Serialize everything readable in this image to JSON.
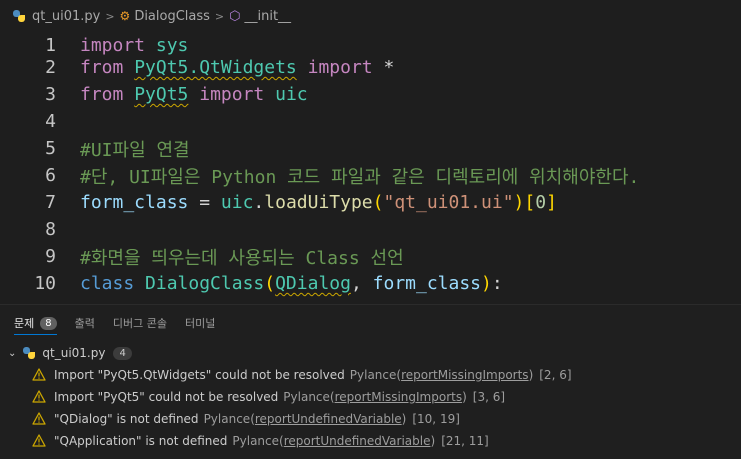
{
  "breadcrumb": {
    "file": "qt_ui01.py",
    "class": "DialogClass",
    "method": "__init__"
  },
  "editor": {
    "line_numbers": [
      "1",
      "2",
      "3",
      "4",
      "5",
      "6",
      "7",
      "8",
      "9",
      "10"
    ],
    "lines": {
      "l1": {
        "kw": "import",
        "mod": "sys"
      },
      "l2": {
        "kw": "from",
        "mod": "PyQt5.QtWidgets",
        "kw2": "import",
        "op": "*"
      },
      "l3": {
        "kw": "from",
        "mod": "PyQt5",
        "kw2": "import",
        "id": "uic"
      },
      "l5": {
        "comment": "#UI파일 연결"
      },
      "l6": {
        "comment": "#단, UI파일은 Python 코드 파일과 같은 디렉토리에 위치해야한다."
      },
      "l7": {
        "var": "form_class",
        "eq": "=",
        "mod": "uic",
        "dot": ".",
        "fn": "loadUiType",
        "open": "(",
        "str": "\"qt_ui01.ui\"",
        "close": ")",
        "idx_open": "[",
        "num": "0",
        "idx_close": "]"
      },
      "l9": {
        "comment": "#화면을 띄우는데 사용되는 Class 선언"
      },
      "l10": {
        "kw": "class",
        "name": "DialogClass",
        "open": "(",
        "base1": "QDialog",
        "comma": ",",
        "base2": "form_class",
        "close": ")",
        "colon": ":"
      }
    }
  },
  "panel": {
    "tabs": [
      {
        "label": "문제",
        "badge": "8"
      },
      {
        "label": "출력"
      },
      {
        "label": "디버그 콘솔"
      },
      {
        "label": "터미널"
      }
    ],
    "file": {
      "name": "qt_ui01.py",
      "count": "4"
    },
    "problems": [
      {
        "message": "Import \"PyQt5.QtWidgets\" could not be resolved",
        "source": "Pylance",
        "code": "reportMissingImports",
        "position": "[2, 6]"
      },
      {
        "message": "Import \"PyQt5\" could not be resolved",
        "source": "Pylance",
        "code": "reportMissingImports",
        "position": "[3, 6]"
      },
      {
        "message": "\"QDialog\" is not defined",
        "source": "Pylance",
        "code": "reportUndefinedVariable",
        "position": "[10, 19]"
      },
      {
        "message": "\"QApplication\" is not defined",
        "source": "Pylance",
        "code": "reportUndefinedVariable",
        "position": "[21, 11]"
      }
    ]
  },
  "colors": {
    "warning": "#cca700",
    "keyword": "#c586c0",
    "class_keyword": "#569cd6",
    "module": "#4ec9b0",
    "comment": "#6a9955",
    "string": "#ce9178"
  },
  "icons": {
    "file": "python-file-icon",
    "class": "class-symbol-icon",
    "method": "method-symbol-icon",
    "warning": "warning-icon",
    "chevron": "chevron-down-icon"
  }
}
